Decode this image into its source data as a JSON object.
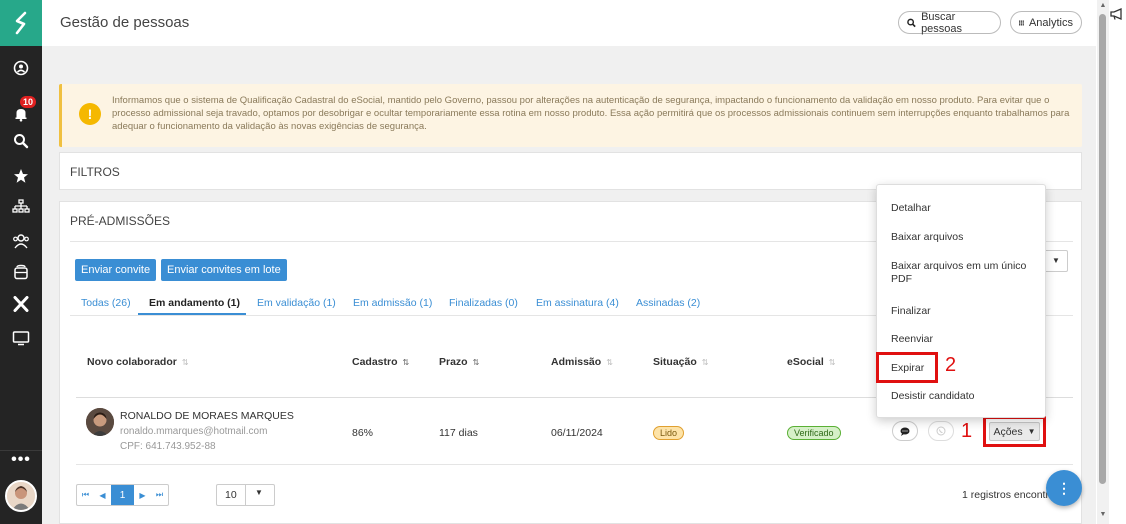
{
  "app": {
    "title": "Gestão de pessoas"
  },
  "header": {
    "search_button": "Buscar pessoas",
    "analytics_button": "Analytics"
  },
  "sidebar": {
    "notification_count": "10",
    "more": "•••"
  },
  "warning": {
    "text": "Informamos que o sistema de Qualificação Cadastral do eSocial, mantido pelo Governo, passou por alterações na autenticação de segurança, impactando o funcionamento da validação em nosso produto. Para evitar que o processo admissional seja travado, optamos por desobrigar e ocultar temporariamente essa rotina em nosso produto. Essa ação permitirá que os processos admissionais continuem sem interrupções enquanto trabalhamos para adequar o funcionamento da validação às novas exigências de segurança."
  },
  "filters": {
    "title": "FILTROS"
  },
  "panel": {
    "title": "PRÉ-ADMISSÕES",
    "send_invite": "Enviar convite",
    "send_batch": "Enviar convites em lote",
    "tabs": [
      {
        "label": "Todas (26)"
      },
      {
        "label": "Em andamento (1)"
      },
      {
        "label": "Em validação (1)"
      },
      {
        "label": "Em admissão (1)"
      },
      {
        "label": "Finalizadas (0)"
      },
      {
        "label": "Em assinatura (4)"
      },
      {
        "label": "Assinadas (2)"
      }
    ],
    "columns": {
      "collaborator": "Novo colaborador",
      "registration": "Cadastro",
      "deadline": "Prazo",
      "admission": "Admissão",
      "status": "Situação",
      "esocial": "eSocial"
    },
    "row": {
      "name": "RONALDO DE MORAES MARQUES",
      "email": "ronaldo.mmarques@hotmail.com",
      "cpf": "CPF: 641.743.952-88",
      "registration": "86%",
      "deadline": "117 dias",
      "admission": "06/11/2024",
      "status": "Lido",
      "esocial": "Verificado",
      "actions": "Ações"
    },
    "pagination": {
      "current_page": "1",
      "page_size": "10",
      "records": "1 registros encontrados"
    }
  },
  "menu": {
    "items": [
      "Detalhar",
      "Baixar arquivos",
      "Baixar arquivos em um único PDF",
      "Finalizar",
      "Reenviar",
      "Expirar",
      "Desistir candidato"
    ]
  },
  "annotations": {
    "one": "1",
    "two": "2"
  },
  "colors": {
    "sidebar": "#242424",
    "brand": "#27a88a",
    "primary": "#3a8ed4",
    "annotation": "#e01010"
  }
}
